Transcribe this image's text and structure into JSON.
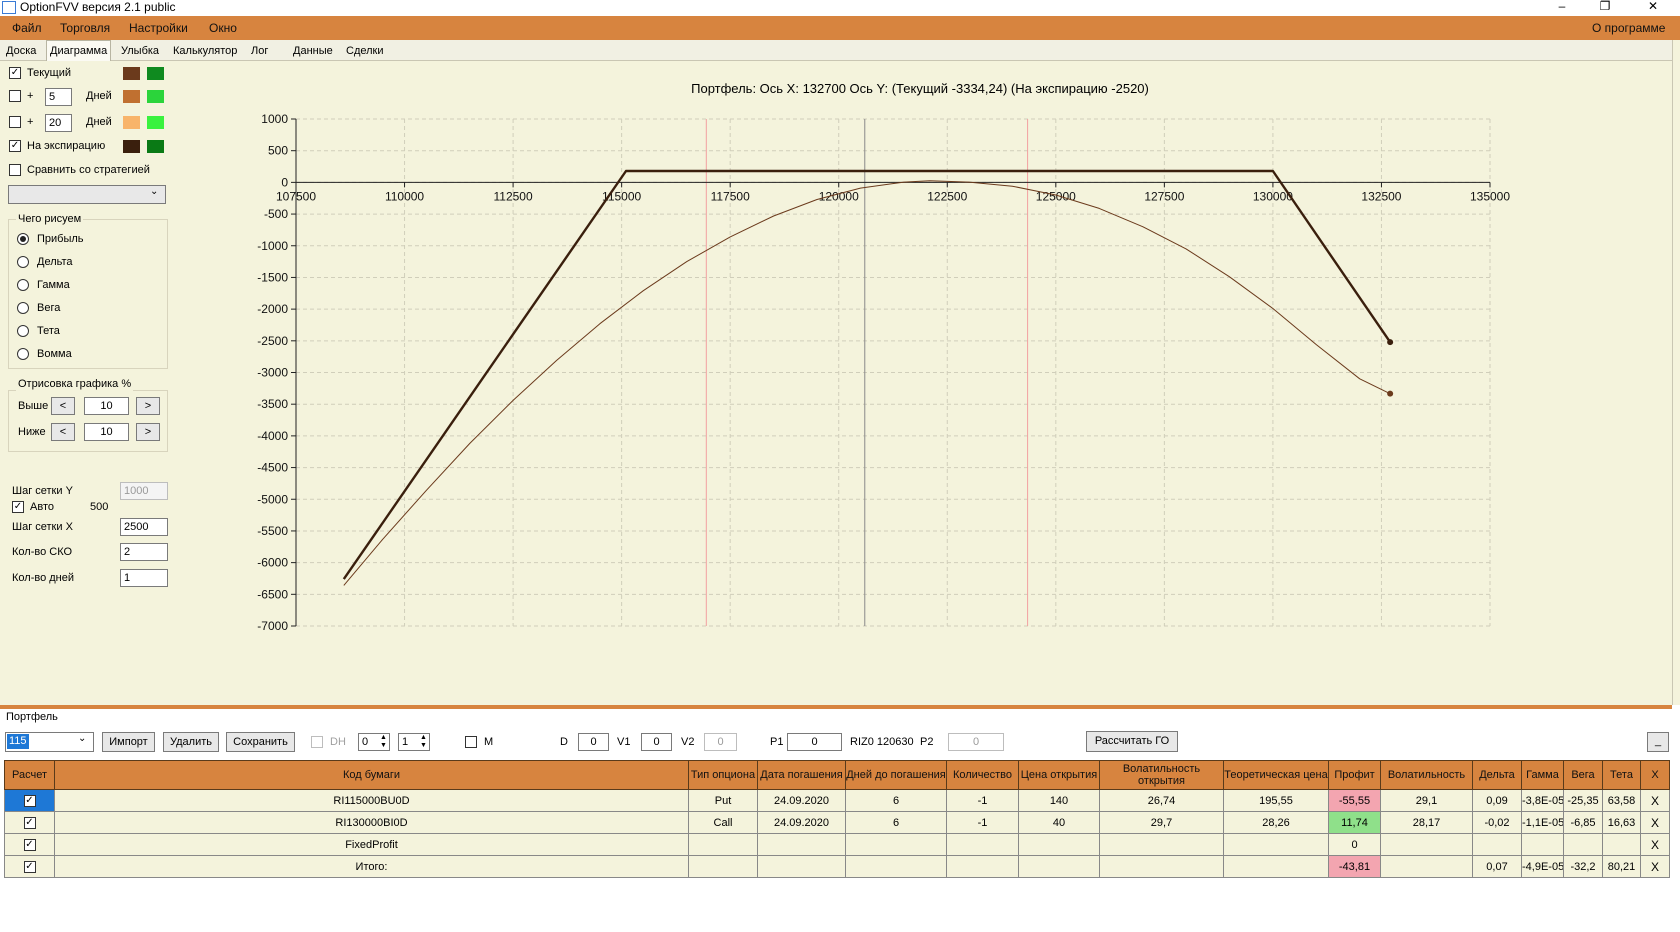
{
  "window": {
    "title": "OptionFVV версия 2.1 public",
    "minimize": "–",
    "restore": "❐",
    "close": "✕"
  },
  "menu": {
    "items": [
      "Файл",
      "Торговля",
      "Настройки",
      "Окно"
    ],
    "about": "О программе"
  },
  "tabs": [
    "Доска",
    "Диаграмма",
    "Улыбка",
    "Калькулятор",
    "Лог",
    "Данные",
    "Сделки"
  ],
  "left": {
    "rows": [
      {
        "label": "Текущий",
        "checked": true,
        "colors": [
          "#6b3a1c",
          "#0f8a1f"
        ]
      },
      {
        "prefix": "+",
        "days": "5",
        "suffix": "Дней",
        "checked": false,
        "colors": [
          "#c07030",
          "#2bd43b"
        ]
      },
      {
        "prefix": "+",
        "days": "20",
        "suffix": "Дней",
        "checked": false,
        "colors": [
          "#f8b46a",
          "#39f23e"
        ]
      },
      {
        "label": "На экспирацию",
        "checked": true,
        "colors": [
          "#3a1f0d",
          "#0a7a15"
        ]
      }
    ],
    "compare_label": "Сравнить со стратегией",
    "draw_group_title": "Чего рисуем",
    "draw_options": [
      "Прибыль",
      "Дельта",
      "Гамма",
      "Вега",
      "Тета",
      "Вомма"
    ],
    "draw_selected": 0,
    "render_title": "Отрисовка графика %",
    "above_label": "Выше",
    "above_value": "10",
    "below_label": "Ниже",
    "below_value": "10",
    "prev_btn": "<",
    "next_btn": ">",
    "grid_y_label": "Шаг сетки Y",
    "grid_y_value": "1000",
    "auto_label": "Авто",
    "auto_value": "500",
    "grid_x_label": "Шаг сетки X",
    "grid_x_value": "2500",
    "sko_label": "Кол-во СКО",
    "sko_value": "2",
    "days_label": "Кол-во дней",
    "days_value": "1"
  },
  "chart_header": "Портфель: Ось X: 132700 Ось Y:  (Текущий -3334,24)  (На экспирацию -2520)",
  "chart_data": {
    "type": "line",
    "xlim": [
      107500,
      135000
    ],
    "ylim": [
      -7000,
      1000
    ],
    "x_ticks": [
      107500,
      110000,
      112500,
      115000,
      117500,
      120000,
      122500,
      125000,
      127500,
      130000,
      132500,
      135000
    ],
    "y_ticks": [
      1000,
      500,
      0,
      -500,
      -1000,
      -1500,
      -2000,
      -2500,
      -3000,
      -3500,
      -4000,
      -4500,
      -5000,
      -5500,
      -6000,
      -6500,
      -7000
    ],
    "grid": true,
    "vlines": [
      {
        "x": 116950,
        "color": "#f2a0a0"
      },
      {
        "x": 120600,
        "color": "#8a8a8a"
      },
      {
        "x": 124350,
        "color": "#f2a0a0"
      }
    ],
    "series": [
      {
        "color": "#3a1f0d",
        "width": 2.4,
        "x": [
          108600,
          115100,
          130000,
          132700
        ],
        "y": [
          -6260,
          180,
          180,
          -2520
        ]
      },
      {
        "color": "#6b3a1c",
        "width": 1,
        "x": [
          108600,
          109500,
          110500,
          111500,
          112500,
          113500,
          114500,
          115500,
          116500,
          117500,
          118500,
          119500,
          120500,
          121500,
          122100,
          123000,
          124000,
          125000,
          126000,
          127000,
          128000,
          129000,
          130000,
          131000,
          132000,
          132700
        ],
        "y": [
          -6360,
          -5630,
          -4860,
          -4120,
          -3440,
          -2810,
          -2230,
          -1710,
          -1250,
          -860,
          -530,
          -270,
          -90,
          5,
          25,
          5,
          -60,
          -200,
          -410,
          -700,
          -1050,
          -1490,
          -1990,
          -2560,
          -3100,
          -3334
        ]
      }
    ],
    "markers": [
      {
        "x": 132700,
        "y": -2520,
        "color": "#3a1f0d"
      },
      {
        "x": 132700,
        "y": -3334,
        "color": "#6b3a1c"
      }
    ]
  },
  "portfolio": {
    "title": "Портфель",
    "selected": "115",
    "import_btn": "Импорт",
    "delete_btn": "Удалить",
    "save_btn": "Сохранить",
    "dh_label": "DH",
    "spin1": "0",
    "spin2": "1",
    "m_label": "M",
    "d_label": "D",
    "d_value": "0",
    "v1_label": "V1",
    "v1_value": "0",
    "v2_label": "V2",
    "v2_value": "0",
    "p1_label": "P1",
    "p1_value": "0",
    "instrument": "RIZ0 120630",
    "p2_label": "P2",
    "p2_value": "0",
    "calc_btn": "Рассчитать ГО",
    "min_btn": "_"
  },
  "table": {
    "headers": [
      "Расчет",
      "Код бумаги",
      "Тип опциона",
      "Дата погашения",
      "Дней до погашения",
      "Количество",
      "Цена открытия",
      "Волатильность открытия",
      "Теоретическая цена",
      "Профит",
      "Волатильность",
      "Дельта",
      "Гамма",
      "Вега",
      "Тета",
      "X"
    ],
    "rows": [
      {
        "code": "RI115000BU0D",
        "type": "Put",
        "date": "24.09.2020",
        "days": "6",
        "qty": "-1",
        "price": "140",
        "vol_open": "26,74",
        "theo": "195,55",
        "profit": "-55,55",
        "profit_color": "pink",
        "vol": "29,1",
        "delta": "0,09",
        "gamma": "-3,8E-05",
        "vega": "-25,35",
        "theta": "63,58",
        "x": "X",
        "selected": true
      },
      {
        "code": "RI130000BI0D",
        "type": "Call",
        "date": "24.09.2020",
        "days": "6",
        "qty": "-1",
        "price": "40",
        "vol_open": "29,7",
        "theo": "28,26",
        "profit": "11,74",
        "profit_color": "green",
        "vol": "28,17",
        "delta": "-0,02",
        "gamma": "-1,1E-05",
        "vega": "-6,85",
        "theta": "16,63",
        "x": "X",
        "selected": false
      },
      {
        "code": "FixedProfit",
        "type": "",
        "date": "",
        "days": "",
        "qty": "",
        "price": "",
        "vol_open": "",
        "theo": "",
        "profit": "0",
        "profit_color": "",
        "vol": "",
        "delta": "",
        "gamma": "",
        "vega": "",
        "theta": "",
        "x": "X",
        "selected": false
      },
      {
        "code": "Итого:",
        "type": "",
        "date": "",
        "days": "",
        "qty": "",
        "price": "",
        "vol_open": "",
        "theo": "",
        "profit": "-43,81",
        "profit_color": "pink",
        "vol": "",
        "delta": "0,07",
        "gamma": "-4,9E-05",
        "vega": "-32,2",
        "theta": "80,21",
        "x": "X",
        "selected": false
      }
    ]
  }
}
